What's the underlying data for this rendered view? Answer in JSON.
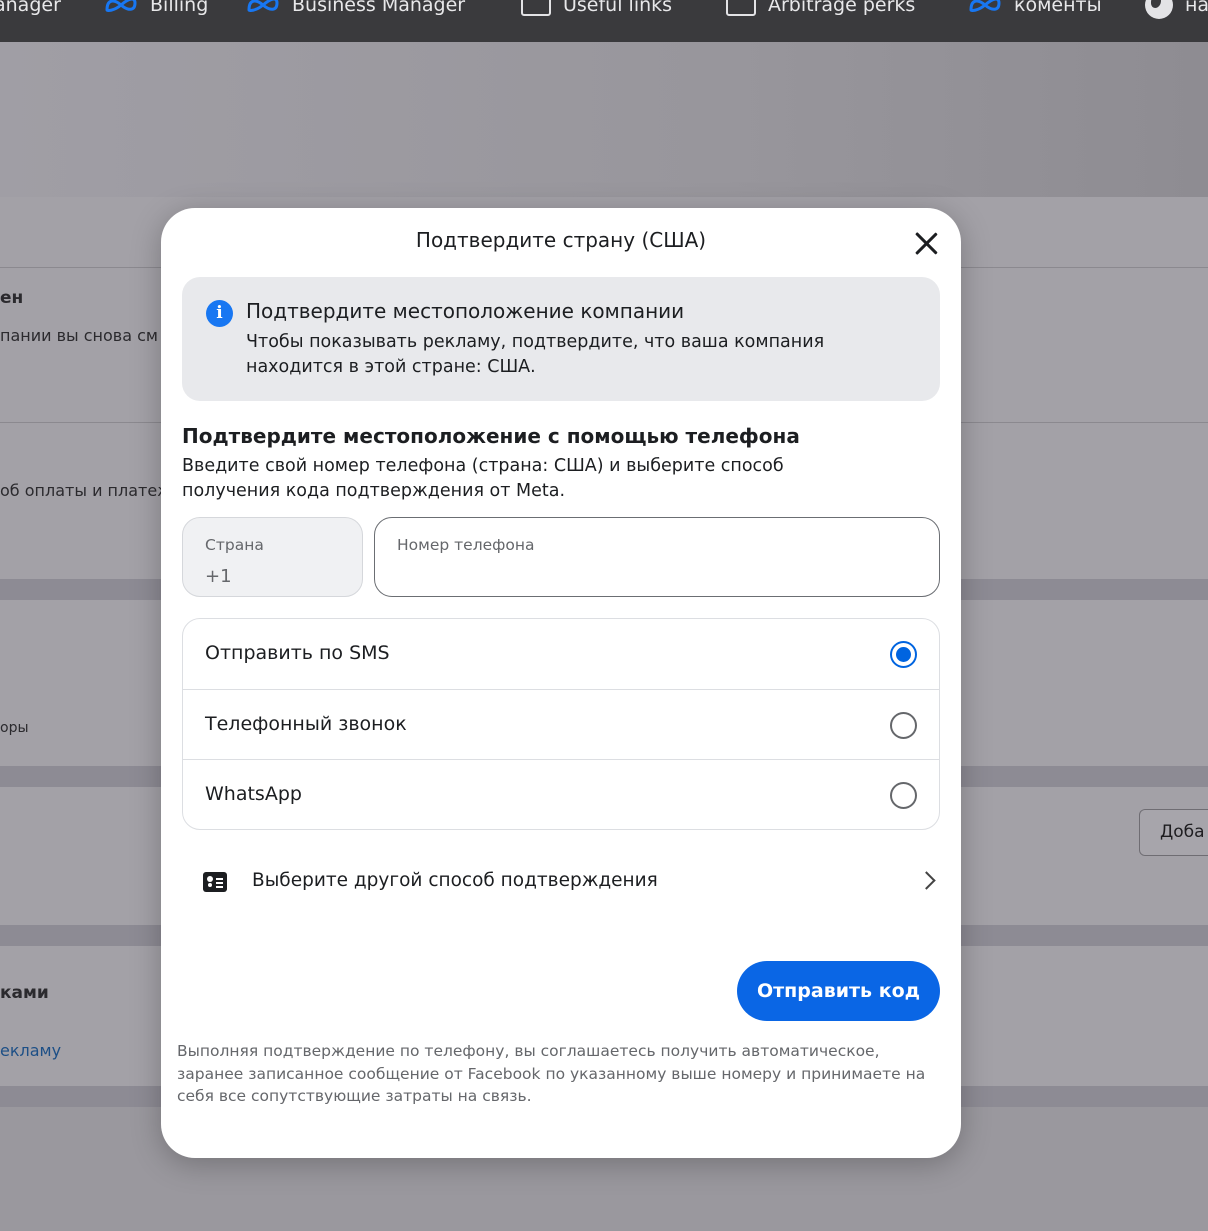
{
  "bookmarks": [
    {
      "label": "anager",
      "icon": "meta-icon"
    },
    {
      "label": "Billing",
      "icon": "meta-icon"
    },
    {
      "label": "Business Manager",
      "icon": "meta-icon"
    },
    {
      "label": "Useful links",
      "icon": "folder-icon"
    },
    {
      "label": "Arbitrage perks",
      "icon": "folder-icon"
    },
    {
      "label": "коменты",
      "icon": "meta-icon"
    },
    {
      "label": "на",
      "icon": "globe-icon"
    }
  ],
  "background_page": {
    "text_1": "ен",
    "text_2": "пании вы снова см",
    "text_3": "об оплаты и платеж",
    "text_4": "оры",
    "button": "Доба",
    "text_5": "ками",
    "link": "екламу"
  },
  "modal": {
    "title": "Подтвердите страну (США)",
    "info": {
      "title": "Подтвердите местоположение компании",
      "text": "Чтобы показывать рекламу, подтвердите, что ваша компания находится в этой стране: США."
    },
    "section": {
      "title": "Подтвердите местоположение с помощью телефона",
      "text": "Введите свой номер телефона (страна: США) и выберите способ получения кода подтверждения от Meta."
    },
    "country_field": {
      "label": "Страна",
      "value": "+1"
    },
    "phone_field": {
      "label": "Номер телефона",
      "value": ""
    },
    "options": [
      {
        "label": "Отправить по SMS",
        "selected": true
      },
      {
        "label": "Телефонный звонок",
        "selected": false
      },
      {
        "label": "WhatsApp",
        "selected": false
      }
    ],
    "other_method": "Выберите другой способ подтверждения",
    "send_button": "Отправить код",
    "disclaimer": "Выполняя подтверждение по телефону, вы соглашаетесь получить автоматическое, заранее записанное сообщение от Facebook по указанному выше номеру и принимаете на себя все сопутствующие затраты на связь."
  },
  "colors": {
    "accent": "#0a66e5",
    "info_box": "#e8e9ec",
    "bookmarks_bar": "#3a3a3d"
  }
}
